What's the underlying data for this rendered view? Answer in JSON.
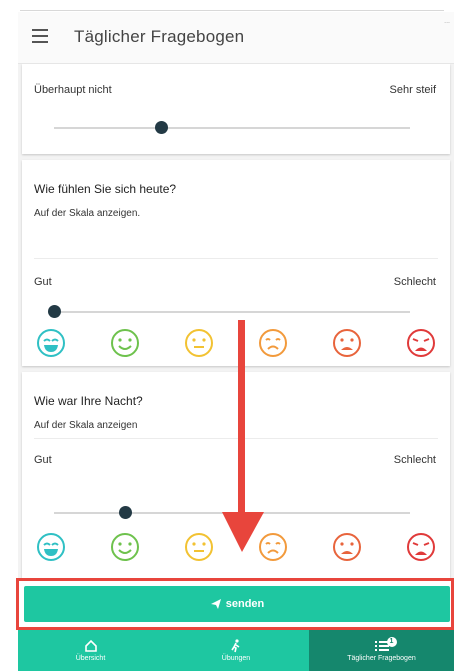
{
  "header": {
    "title": "Täglicher Fragebogen",
    "corner_text": "..."
  },
  "card1": {
    "label_left": "Überhaupt nicht",
    "label_right": "Sehr steif",
    "slider_value": 0.3
  },
  "card2": {
    "question": "Wie fühlen Sie sich heute?",
    "instruction": "Auf der Skala anzeigen.",
    "label_left": "Gut",
    "label_right": "Schlecht",
    "slider_value": 0.0
  },
  "card3": {
    "question": "Wie war Ihre Nacht?",
    "instruction": "Auf der Skala anzeigen",
    "label_left": "Gut",
    "label_right": "Schlecht",
    "slider_value": 0.2
  },
  "emojis": [
    {
      "icon": "very-happy-face-icon",
      "color": "#2fc0c4"
    },
    {
      "icon": "happy-face-icon",
      "color": "#6ec24d"
    },
    {
      "icon": "neutral-face-icon",
      "color": "#f2c232"
    },
    {
      "icon": "sad-face-icon",
      "color": "#f29a3c"
    },
    {
      "icon": "very-sad-face-icon",
      "color": "#e8643c"
    },
    {
      "icon": "crying-face-icon",
      "color": "#e03a3a"
    }
  ],
  "send_button": {
    "label": "senden"
  },
  "bottom_nav": [
    {
      "label": "Übersicht",
      "icon": "home-icon"
    },
    {
      "label": "Übungen",
      "icon": "walking-person-icon"
    },
    {
      "label": "Täglicher Fragebogen",
      "icon": "list-icon",
      "badge": "1"
    }
  ],
  "colors": {
    "accent": "#1ec7a1",
    "accent_dark": "#15876d",
    "highlight": "#e8453c"
  }
}
